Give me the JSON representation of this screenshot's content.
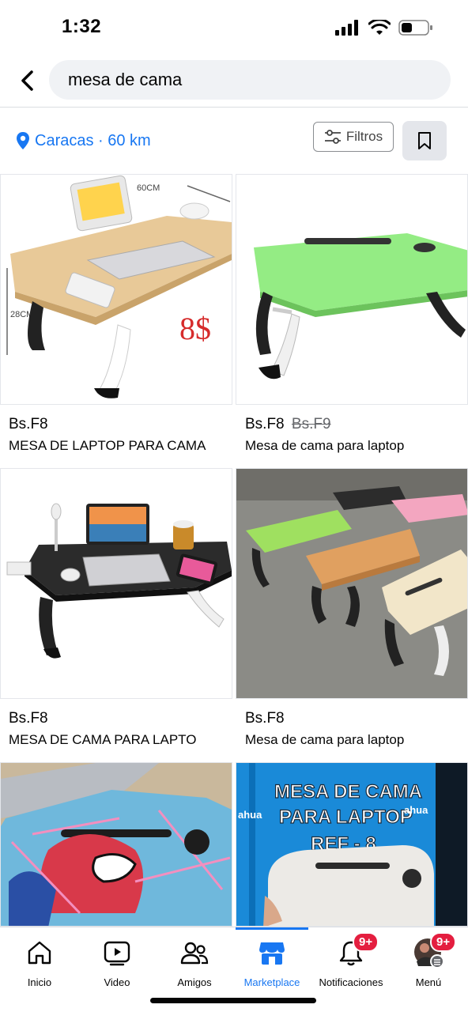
{
  "status": {
    "time": "1:32"
  },
  "search": {
    "query": "mesa de cama"
  },
  "location": {
    "label": "Caracas · 60 km"
  },
  "filters": {
    "label": "Filtros"
  },
  "listings": [
    {
      "price": "Bs.F8",
      "old_price": "",
      "title": "MESA DE LAPTOP PARA CAMA",
      "image_text": [
        "60CM",
        "28CM",
        "8$"
      ]
    },
    {
      "price": "Bs.F8",
      "old_price": "Bs.F9",
      "title": "Mesa de cama para laptop",
      "image_text": []
    },
    {
      "price": "Bs.F8",
      "old_price": "",
      "title": "MESA DE CAMA PARA LAPTO",
      "image_text": []
    },
    {
      "price": "Bs.F8",
      "old_price": "",
      "title": "Mesa de cama para laptop",
      "image_text": []
    },
    {
      "price": "",
      "old_price": "",
      "title": "",
      "image_text": []
    },
    {
      "price": "",
      "old_price": "",
      "title": "",
      "image_text": [
        "MESA DE CAMA",
        "PARA LAPTOP",
        "REF - 8",
        "ahua",
        "ahua"
      ]
    }
  ],
  "nav": [
    {
      "label": "Inicio",
      "icon": "home-icon"
    },
    {
      "label": "Video",
      "icon": "video-icon"
    },
    {
      "label": "Amigos",
      "icon": "friends-icon"
    },
    {
      "label": "Marketplace",
      "icon": "marketplace-icon",
      "active": true
    },
    {
      "label": "Notificaciones",
      "icon": "bell-icon",
      "badge": "9+"
    },
    {
      "label": "Menú",
      "icon": "avatar",
      "badge": "9+"
    }
  ],
  "colors": {
    "accent": "#1877f2",
    "badge": "#e41e3f",
    "search_bg": "#f0f2f5"
  }
}
